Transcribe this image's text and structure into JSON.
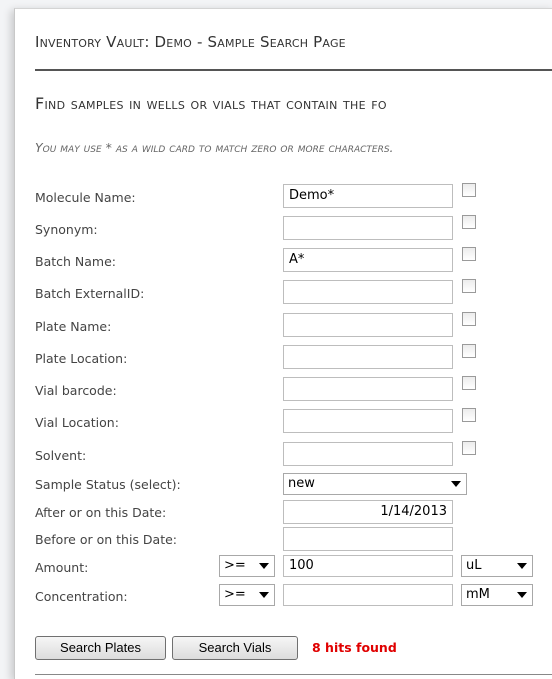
{
  "page": {
    "title": "Inventory Vault: Demo - Sample Search Page",
    "heading": "Find samples in wells or vials that contain the fo",
    "hint": "You may use * as a wild card to match zero or more characters."
  },
  "fields": [
    {
      "label": "Molecule Name:",
      "value": "Demo*"
    },
    {
      "label": "Synonym:",
      "value": ""
    },
    {
      "label": "Batch Name:",
      "value": "A*"
    },
    {
      "label": "Batch ExternalID:",
      "value": ""
    },
    {
      "label": "Plate Name:",
      "value": ""
    },
    {
      "label": "Plate Location:",
      "value": ""
    },
    {
      "label": "Vial barcode:",
      "value": ""
    },
    {
      "label": "Vial Location:",
      "value": ""
    },
    {
      "label": "Solvent:",
      "value": ""
    }
  ],
  "sample_status": {
    "label": "Sample Status (select):",
    "selected": "new"
  },
  "after_date": {
    "label": "After or on this Date:",
    "value": "1/14/2013"
  },
  "before_date": {
    "label": "Before or on this Date:",
    "value": ""
  },
  "amount": {
    "label": "Amount:",
    "operator": ">=",
    "value": "100",
    "unit": "uL"
  },
  "concentration": {
    "label": "Concentration:",
    "operator": ">=",
    "value": "",
    "unit": "mM"
  },
  "buttons": {
    "search_plates": "Search Plates",
    "search_vials": "Search Vials"
  },
  "result": {
    "hits_text": "8 hits found",
    "color": "#e00000"
  }
}
